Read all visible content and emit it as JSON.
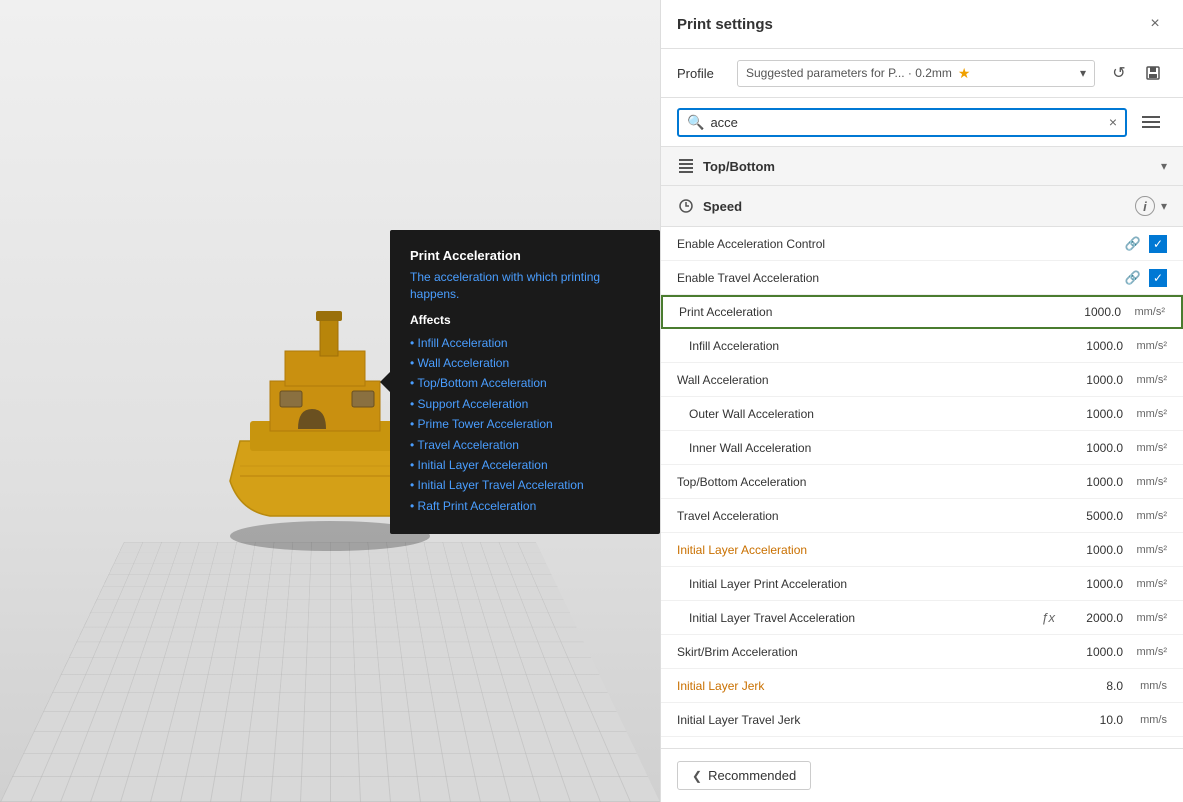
{
  "viewport": {
    "background": "#e8e8e8"
  },
  "tooltip": {
    "title": "Print Acceleration",
    "description": "The acceleration with which printing happens.",
    "affects_label": "Affects",
    "affects_list": [
      "Infill Acceleration",
      "Wall Acceleration",
      "Top/Bottom Acceleration",
      "Support Acceleration",
      "Prime Tower Acceleration",
      "Travel Acceleration",
      "Initial Layer Acceleration",
      "Initial Layer Travel Acceleration",
      "Raft Print Acceleration"
    ]
  },
  "panel": {
    "title": "Print settings",
    "close_label": "×"
  },
  "profile": {
    "label": "Profile",
    "value": "Suggested parameters for P...  · 0.2mm",
    "star": "★",
    "reset_label": "↺",
    "save_label": "💾"
  },
  "search": {
    "placeholder": "acce",
    "value": "acce",
    "clear_label": "×",
    "hamburger_label": "☰"
  },
  "sections": [
    {
      "id": "top-bottom",
      "icon": "≡",
      "title": "Top/Bottom",
      "expanded": true
    },
    {
      "id": "speed",
      "icon": "⟳",
      "title": "Speed",
      "has_info": true,
      "expanded": true
    }
  ],
  "settings_rows": [
    {
      "id": "enable-acceleration-control",
      "label": "Enable Acceleration Control",
      "has_link": true,
      "type": "checkbox",
      "checked": true,
      "sub": false,
      "orange": false
    },
    {
      "id": "enable-travel-acceleration",
      "label": "Enable Travel Acceleration",
      "has_link": true,
      "type": "checkbox",
      "checked": true,
      "sub": false,
      "orange": false
    },
    {
      "id": "print-acceleration",
      "label": "Print Acceleration",
      "has_link": false,
      "type": "value",
      "value": "1000.0",
      "unit": "mm/s²",
      "highlighted": true,
      "sub": false,
      "orange": false
    },
    {
      "id": "infill-acceleration",
      "label": "Infill Acceleration",
      "has_link": false,
      "type": "value",
      "value": "1000.0",
      "unit": "mm/s²",
      "sub": true,
      "orange": false
    },
    {
      "id": "wall-acceleration",
      "label": "Wall Acceleration",
      "has_link": false,
      "type": "value",
      "value": "1000.0",
      "unit": "mm/s²",
      "sub": false,
      "orange": false
    },
    {
      "id": "outer-wall-acceleration",
      "label": "Outer Wall Acceleration",
      "has_link": false,
      "type": "value",
      "value": "1000.0",
      "unit": "mm/s²",
      "sub": true,
      "orange": false
    },
    {
      "id": "inner-wall-acceleration",
      "label": "Inner Wall Acceleration",
      "has_link": false,
      "type": "value",
      "value": "1000.0",
      "unit": "mm/s²",
      "sub": true,
      "orange": false
    },
    {
      "id": "top-bottom-acceleration",
      "label": "Top/Bottom Acceleration",
      "has_link": false,
      "type": "value",
      "value": "1000.0",
      "unit": "mm/s²",
      "sub": false,
      "orange": false
    },
    {
      "id": "travel-acceleration",
      "label": "Travel Acceleration",
      "has_link": false,
      "type": "value",
      "value": "5000.0",
      "unit": "mm/s²",
      "sub": false,
      "orange": false
    },
    {
      "id": "initial-layer-acceleration",
      "label": "Initial Layer Acceleration",
      "has_link": false,
      "type": "value",
      "value": "1000.0",
      "unit": "mm/s²",
      "sub": false,
      "orange": true
    },
    {
      "id": "initial-layer-print-acceleration",
      "label": "Initial Layer Print Acceleration",
      "has_link": false,
      "type": "value",
      "value": "1000.0",
      "unit": "mm/s²",
      "sub": true,
      "orange": false
    },
    {
      "id": "initial-layer-travel-acceleration",
      "label": "Initial Layer Travel Acceleration",
      "has_link": false,
      "has_fx": true,
      "type": "value",
      "value": "2000.0",
      "unit": "mm/s²",
      "sub": true,
      "orange": false
    },
    {
      "id": "skirt-brim-acceleration",
      "label": "Skirt/Brim Acceleration",
      "has_link": false,
      "type": "value",
      "value": "1000.0",
      "unit": "mm/s²",
      "sub": false,
      "orange": false
    },
    {
      "id": "initial-layer-jerk",
      "label": "Initial Layer Jerk",
      "has_link": false,
      "type": "value",
      "value": "8.0",
      "unit": "mm/s",
      "sub": false,
      "orange": true
    },
    {
      "id": "initial-layer-travel-jerk",
      "label": "Initial Layer Travel Jerk",
      "has_link": false,
      "type": "value",
      "value": "10.0",
      "unit": "mm/s",
      "sub": false,
      "orange": false
    }
  ],
  "bottom": {
    "recommended_label": "Recommended",
    "chevron_left": "❮"
  }
}
